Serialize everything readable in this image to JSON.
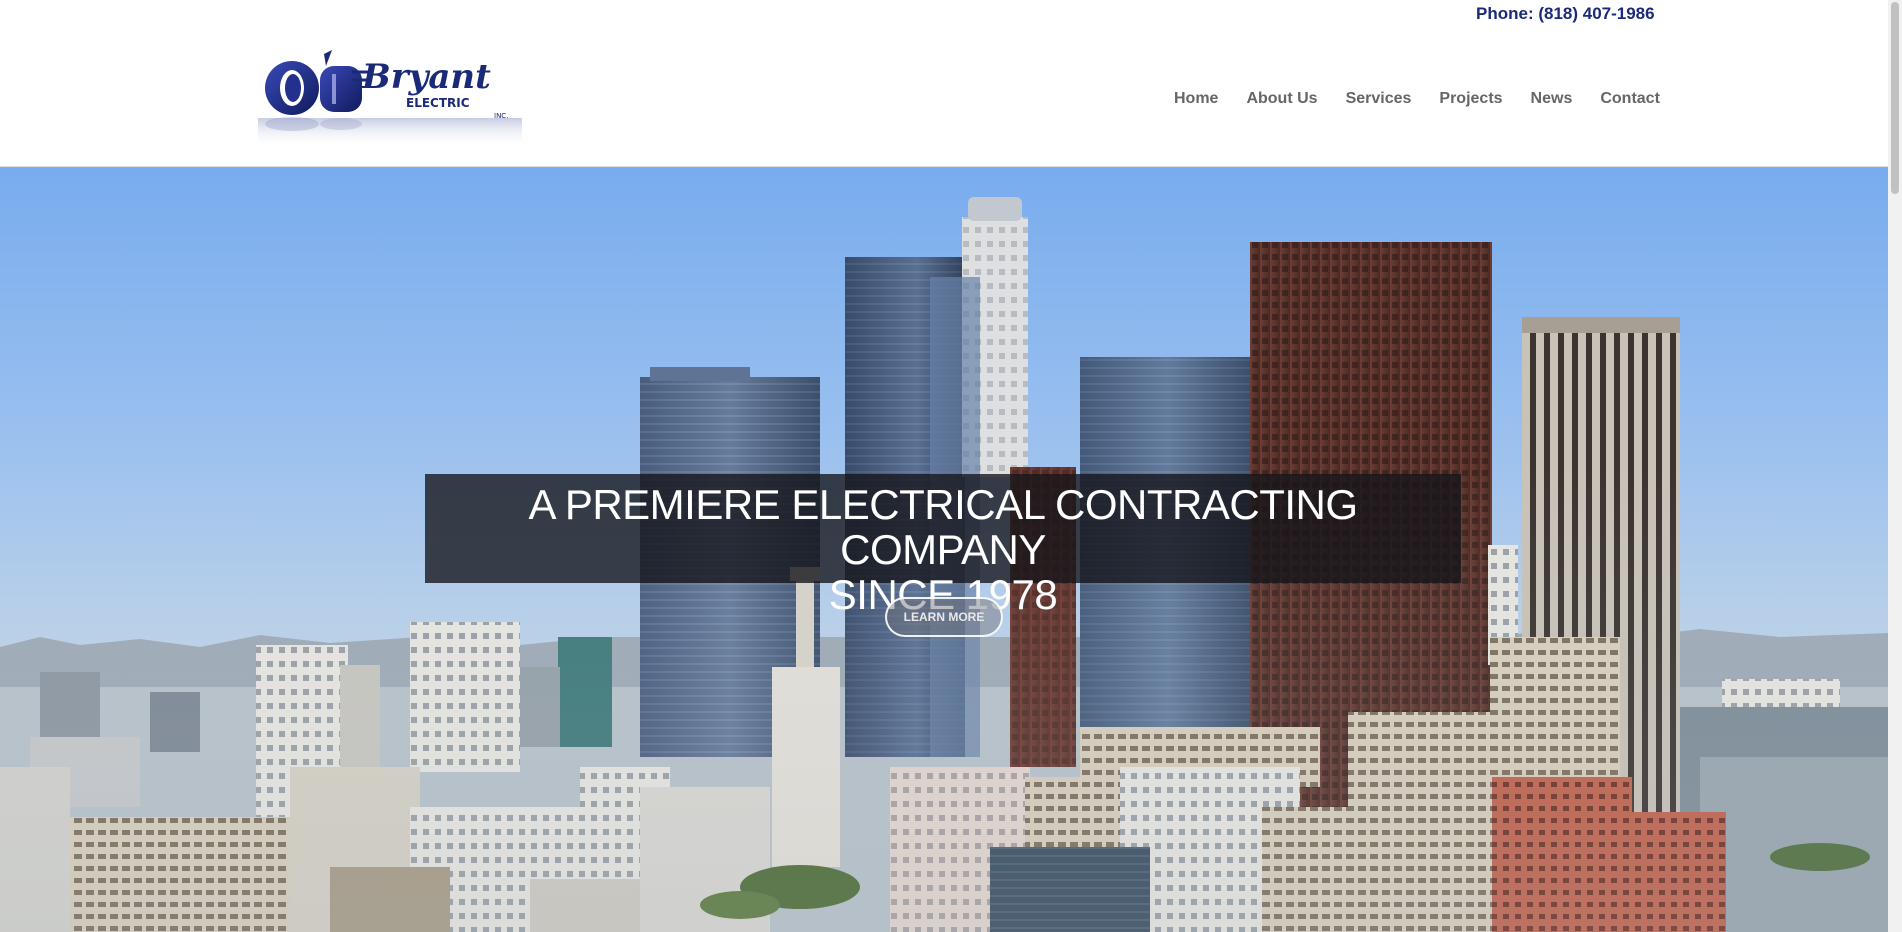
{
  "header": {
    "phone": "Phone: (818) 407-1986",
    "logo": {
      "name": "O'Bryant Electric Inc.",
      "text_main": "Bryant",
      "text_sub": "ELECTRIC",
      "text_inc": "INC."
    }
  },
  "nav": {
    "items": [
      {
        "label": "Home"
      },
      {
        "label": "About Us"
      },
      {
        "label": "Services"
      },
      {
        "label": "Projects"
      },
      {
        "label": "News"
      },
      {
        "label": "Contact"
      }
    ]
  },
  "hero": {
    "headline_line1": "A PREMIERE ELECTRICAL CONTRACTING COMPANY",
    "headline_line2": "SINCE 1978",
    "button_label": "LEARN MORE",
    "image": "city-skyline"
  },
  "colors": {
    "brand_blue": "#1b2a78",
    "nav_gray": "#666666",
    "sky_top": "#78acee"
  }
}
